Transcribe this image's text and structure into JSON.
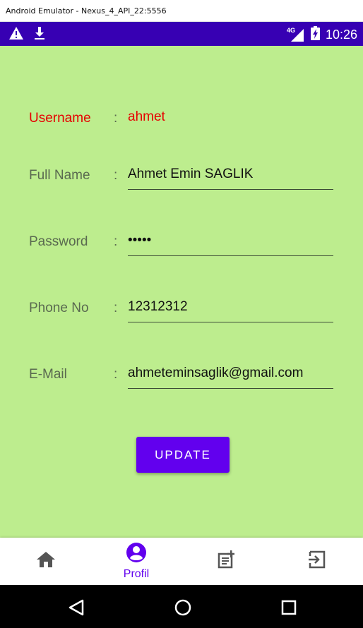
{
  "window": {
    "title": "Android Emulator - Nexus_4_API_22:5556"
  },
  "status_bar": {
    "time": "10:26",
    "network": "4G",
    "icons": [
      "warning-icon",
      "download-icon",
      "signal-icon",
      "battery-charging-icon"
    ]
  },
  "profile": {
    "username": {
      "label": "Username",
      "value": "ahmet"
    },
    "full_name": {
      "label": "Full Name",
      "value": "Ahmet Emin SAGLIK"
    },
    "password": {
      "label": "Password",
      "value": "•••••"
    },
    "phone": {
      "label": "Phone No",
      "value": "12312312"
    },
    "email": {
      "label": "E-Mail",
      "value": "ahmeteminsaglik@gmail.com"
    },
    "separator": ":"
  },
  "update_button": {
    "label": "UPDATE"
  },
  "bottom_nav": {
    "items": [
      {
        "icon": "home-icon",
        "label": ""
      },
      {
        "icon": "account-circle-icon",
        "label": "Profil"
      },
      {
        "icon": "post-add-icon",
        "label": ""
      },
      {
        "icon": "logout-icon",
        "label": ""
      }
    ],
    "active_index": 1
  },
  "system_nav": {
    "icons": [
      "back-icon",
      "home-circle-icon",
      "recents-icon"
    ]
  },
  "colors": {
    "background": "#bded8e",
    "accent": "#6200ee",
    "status_bar": "#3700b3",
    "username": "#e60000"
  }
}
